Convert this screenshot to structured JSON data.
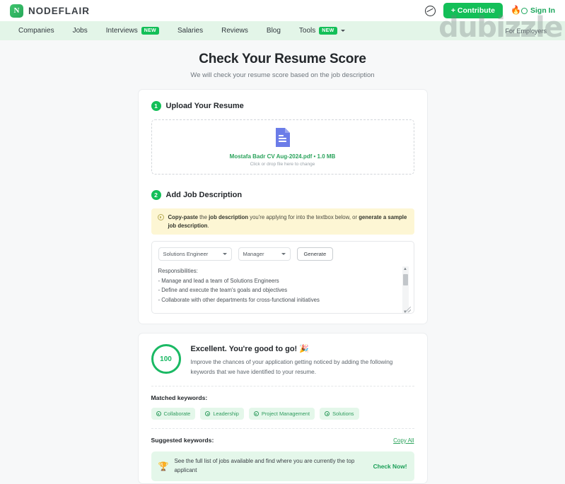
{
  "brand": {
    "name": "NODEFLAIR",
    "logo_icon": "nodeflair-logo-icon"
  },
  "topbar": {
    "language_icon": "globe-icon",
    "contribute_label": "+ Contribute",
    "signin_label": "Sign In",
    "flame_icon": "flame-icon"
  },
  "nav": {
    "items": [
      {
        "label": "Companies",
        "badge": ""
      },
      {
        "label": "Jobs",
        "badge": ""
      },
      {
        "label": "Interviews",
        "badge": "NEW"
      },
      {
        "label": "Salaries",
        "badge": ""
      },
      {
        "label": "Reviews",
        "badge": ""
      },
      {
        "label": "Blog",
        "badge": ""
      },
      {
        "label": "Tools",
        "badge": "NEW"
      }
    ],
    "right_label": "For Employers"
  },
  "watermark": "dubizzle",
  "page": {
    "title": "Check Your Resume Score",
    "subtitle": "We will check your resume score based on the job description"
  },
  "step1": {
    "number": "1",
    "title": "Upload Your Resume",
    "file_icon": "pdf-file-icon",
    "file_name": "Mostafa Badr CV Aug-2024.pdf • 1.0 MB",
    "hint": "Click or drop file here to change"
  },
  "step2": {
    "number": "2",
    "title": "Add Job Description",
    "notice_icon": "info-icon",
    "notice": {
      "p1": "Copy-paste",
      "p2": " the ",
      "p3": "job description",
      "p4": " you're applying for into the textbox below, or ",
      "p5": "generate a sample job description",
      "p6": "."
    },
    "role_select": "Solutions Engineer",
    "level_select": "Manager",
    "generate_label": "Generate",
    "job_description": "Responsibilities:\n- Manage and lead a team of Solutions Engineers\n- Define and execute the team's goals and objectives\n- Collaborate with other departments for cross-functional initiatives\n\nRequirements:",
    "scroll_up_icon": "chevron-up-icon",
    "scroll_down_icon": "chevron-down-icon",
    "resize_icon": "resize-grip-icon"
  },
  "result": {
    "score": "100",
    "headline": "Excellent. You're good to go! 🎉",
    "description": "Improve the chances of your application getting noticed by adding the following keywords that we have identified to your resume.",
    "matched_label": "Matched keywords:",
    "matched_keywords": [
      "Collaborate",
      "Leadership",
      "Project Management",
      "Solutions"
    ],
    "suggested_label": "Suggested keywords:",
    "copy_all_label": "Copy All",
    "promo_icon": "trophy-icon",
    "promo_text": "See the full list of jobs available and find where you are currently the top applicant",
    "promo_cta": "Check Now!"
  },
  "colors": {
    "brand_green": "#13bf58",
    "nav_bg": "#e3f5e8",
    "accent_green": "#2aa35b",
    "notice_yellow": "#fdf6d4",
    "pdf_blue": "#6b7ce8"
  }
}
